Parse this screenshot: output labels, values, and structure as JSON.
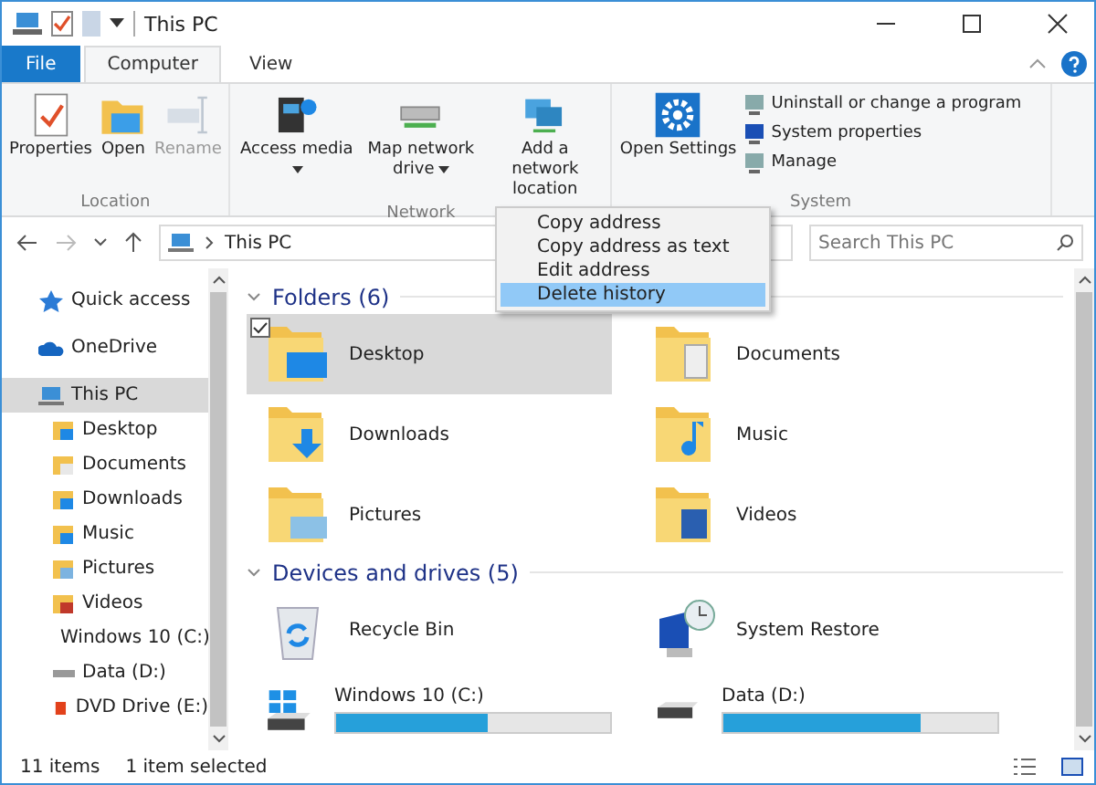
{
  "window": {
    "title": "This PC"
  },
  "tabs": [
    {
      "label": "File",
      "kind": "file",
      "selected": false
    },
    {
      "label": "Computer",
      "kind": "tab",
      "selected": true
    },
    {
      "label": "View",
      "kind": "tab",
      "selected": false
    }
  ],
  "ribbon_groups": [
    {
      "name": "Location",
      "buttons": [
        {
          "label": "Properties",
          "disabled": false,
          "dropdown": false
        },
        {
          "label": "Open",
          "disabled": false,
          "dropdown": false
        },
        {
          "label": "Rename",
          "disabled": true,
          "dropdown": false
        }
      ]
    },
    {
      "name": "Network",
      "buttons": [
        {
          "label": "Access media",
          "disabled": false,
          "dropdown": true
        },
        {
          "label": "Map network drive",
          "disabled": false,
          "dropdown": true
        },
        {
          "label": "Add a network location",
          "disabled": false,
          "dropdown": false
        }
      ]
    },
    {
      "name": "System",
      "buttons": [
        {
          "label": "Open Settings",
          "disabled": false,
          "dropdown": false
        }
      ],
      "small_buttons": [
        "Uninstall or change a program",
        "System properties",
        "Manage"
      ]
    }
  ],
  "address": {
    "path": "This PC",
    "search_placeholder": "Search This PC"
  },
  "nav": [
    {
      "label": "Quick access",
      "selected": false
    },
    {
      "label": "OneDrive",
      "selected": false
    },
    {
      "label": "This PC",
      "selected": true,
      "children": [
        {
          "label": "Desktop",
          "selected": false
        },
        {
          "label": "Documents",
          "selected": false
        },
        {
          "label": "Downloads",
          "selected": false
        },
        {
          "label": "Music",
          "selected": false
        },
        {
          "label": "Pictures",
          "selected": false
        },
        {
          "label": "Videos",
          "selected": false
        },
        {
          "label": "Windows 10 (C:)",
          "selected": false
        },
        {
          "label": "Data (D:)",
          "selected": false
        },
        {
          "label": "DVD Drive (E:)",
          "selected": false
        }
      ]
    }
  ],
  "folders": {
    "heading": "Folders (6)",
    "expanded": true,
    "items": [
      {
        "label": "Desktop",
        "selected": true
      },
      {
        "label": "Documents",
        "selected": false
      },
      {
        "label": "Downloads",
        "selected": false
      },
      {
        "label": "Music",
        "selected": false
      },
      {
        "label": "Pictures",
        "selected": false
      },
      {
        "label": "Videos",
        "selected": false
      }
    ]
  },
  "devices": {
    "heading": "Devices and drives (5)",
    "expanded": true,
    "items": [
      {
        "label": "Recycle Bin",
        "kind": "recycle"
      },
      {
        "label": "System Restore",
        "kind": "restore"
      },
      {
        "label": "Windows 10 (C:)",
        "kind": "drive",
        "level": 0.55
      },
      {
        "label": "Data (D:)",
        "kind": "drive",
        "level": 0.72
      }
    ]
  },
  "context_menu": [
    {
      "label": "Copy address",
      "selected": false
    },
    {
      "label": "Copy address as text",
      "selected": false
    },
    {
      "label": "Edit address",
      "selected": false
    },
    {
      "label": "Delete history",
      "selected": true
    }
  ],
  "status_bar": {
    "count": "11 items",
    "selection": "1 item selected"
  }
}
